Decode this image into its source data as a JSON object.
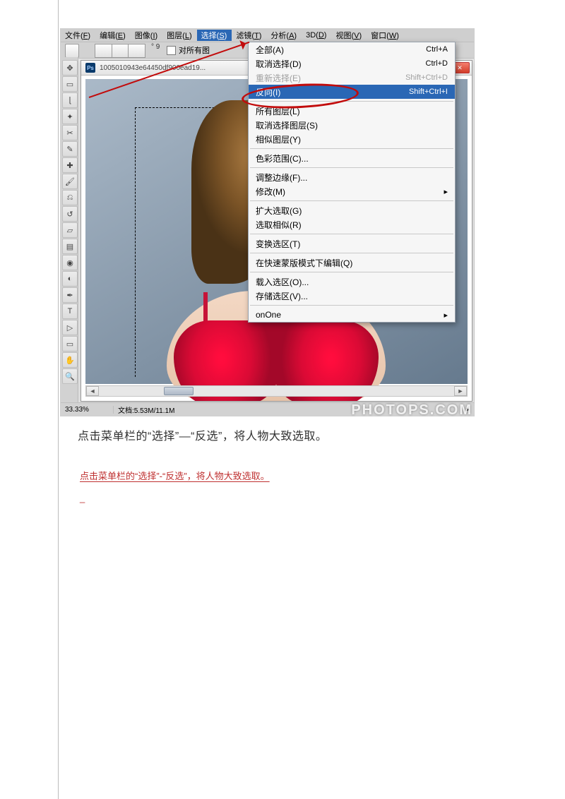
{
  "menubar": [
    {
      "label": "文件(F)",
      "u": "F"
    },
    {
      "label": "编辑(E)",
      "u": "E"
    },
    {
      "label": "图像(I)",
      "u": "I"
    },
    {
      "label": "图层(L)",
      "u": "L"
    },
    {
      "label": "选择(S)",
      "u": "S",
      "open": true
    },
    {
      "label": "滤镜(T)",
      "u": "T"
    },
    {
      "label": "分析(A)",
      "u": "A"
    },
    {
      "label": "3D(D)",
      "u": "D"
    },
    {
      "label": "视图(V)",
      "u": "V"
    },
    {
      "label": "窗口(W)",
      "u": "W"
    }
  ],
  "optbar": {
    "size_digit": "9",
    "checkbox_label": "对所有图"
  },
  "doc": {
    "title": "1005010943e64450df900ead19...",
    "zoom": "33.33%",
    "docinfo": "文档:5.53M/11.1M"
  },
  "menu_items": [
    {
      "label": "全部(A)",
      "shortcut": "Ctrl+A"
    },
    {
      "label": "取消选择(D)",
      "shortcut": "Ctrl+D"
    },
    {
      "label": "重新选择(E)",
      "shortcut": "Shift+Ctrl+D",
      "disabled": true
    },
    {
      "label": "反向(I)",
      "shortcut": "Shift+Ctrl+I",
      "highlight": true
    },
    {
      "sep": true
    },
    {
      "label": "所有图层(L)"
    },
    {
      "label": "取消选择图层(S)"
    },
    {
      "label": "相似图层(Y)"
    },
    {
      "sep": true
    },
    {
      "label": "色彩范围(C)..."
    },
    {
      "sep": true
    },
    {
      "label": "调整边缘(F)..."
    },
    {
      "label": "修改(M)",
      "arrow": true
    },
    {
      "sep": true
    },
    {
      "label": "扩大选取(G)"
    },
    {
      "label": "选取相似(R)"
    },
    {
      "sep": true
    },
    {
      "label": "变换选区(T)"
    },
    {
      "sep": true
    },
    {
      "label": "在快速蒙版模式下编辑(Q)"
    },
    {
      "sep": true
    },
    {
      "label": "载入选区(O)..."
    },
    {
      "label": "存储选区(V)..."
    },
    {
      "sep": true
    },
    {
      "label": "onOne",
      "arrow": true
    }
  ],
  "tool_icons": [
    "move",
    "marquee",
    "lasso",
    "wand",
    "crop",
    "eyedrop",
    "heal",
    "brush",
    "stamp",
    "history",
    "eraser",
    "gradient",
    "blur",
    "dodge",
    "pen",
    "type",
    "path",
    "shape",
    "hand",
    "zoom"
  ],
  "caption": "点击菜单栏的“选择”—“反选”，将人物大致选取。",
  "linked_caption": "点击菜单栏的“选择”-“反选”，将人物大致选取。",
  "tiny": "_",
  "watermark": "PHOTOPS.COM"
}
